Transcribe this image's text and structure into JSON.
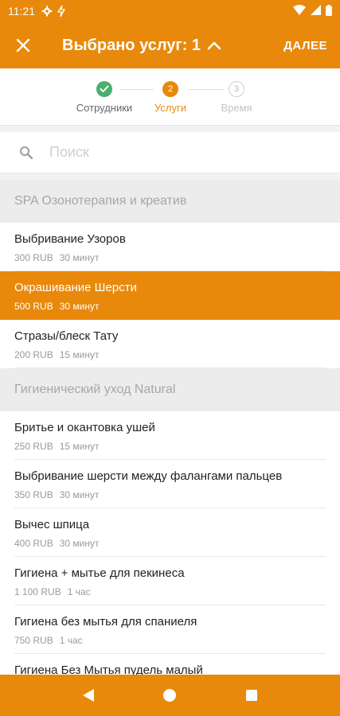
{
  "status_bar": {
    "time": "11:21"
  },
  "toolbar": {
    "title": "Выбрано услуг: 1",
    "next_label": "ДАЛЕЕ"
  },
  "stepper": {
    "steps": [
      {
        "number": "",
        "label": "Сотрудники",
        "state": "done"
      },
      {
        "number": "2",
        "label": "Услуги",
        "state": "active"
      },
      {
        "number": "3",
        "label": "Время",
        "state": "todo"
      }
    ]
  },
  "search": {
    "placeholder": "Поиск",
    "value": ""
  },
  "groups": [
    {
      "title": "SPA Озонотерапия и креатив",
      "items": [
        {
          "name": "Выбривание Узоров",
          "price": "300 RUB",
          "duration": "30 минут"
        },
        {
          "name": "Окрашивание Шерсти",
          "price": "500 RUB",
          "duration": "30 минут",
          "selected": true
        },
        {
          "name": "Стразы/блеск Тату",
          "price": "200 RUB",
          "duration": "15 минут"
        }
      ]
    },
    {
      "title": "Гигиенический уход Natural",
      "items": [
        {
          "name": "Бритье и окантовка ушей",
          "price": "250 RUB",
          "duration": "15 минут"
        },
        {
          "name": "Выбривание шерсти между фалангами пальцев",
          "price": "350 RUB",
          "duration": "30 минут"
        },
        {
          "name": "Вычес шпица",
          "price": "400 RUB",
          "duration": "30 минут"
        },
        {
          "name": "Гигиена + мытье для пекинеса",
          "price": "1 100 RUB",
          "duration": "1 час"
        },
        {
          "name": "Гигиена без мытья для спаниеля",
          "price": "750 RUB",
          "duration": "1 час"
        },
        {
          "name": "Гигиена Без Мытья пудель малый",
          "price": "",
          "duration": ""
        }
      ]
    }
  ],
  "colors": {
    "accent": "#e8890c",
    "done": "#4caf6e"
  }
}
